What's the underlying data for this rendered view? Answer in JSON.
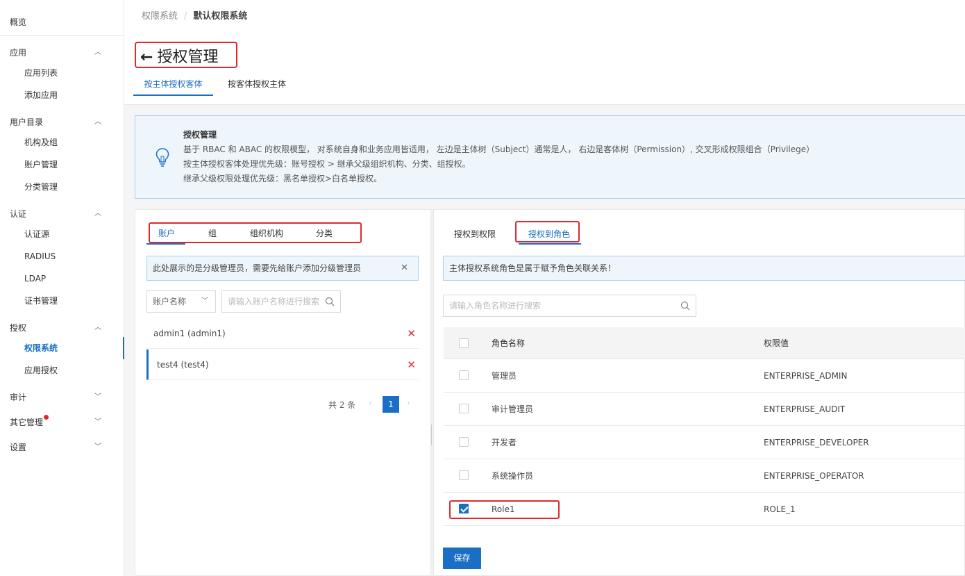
{
  "sidebar": {
    "overview": "概览",
    "groups": [
      {
        "label": "应用",
        "expanded": true,
        "items": [
          "应用列表",
          "添加应用"
        ]
      },
      {
        "label": "用户目录",
        "expanded": true,
        "items": [
          "机构及组",
          "账户管理",
          "分类管理"
        ]
      },
      {
        "label": "认证",
        "expanded": true,
        "items": [
          "认证源",
          "RADIUS",
          "LDAP",
          "证书管理"
        ]
      },
      {
        "label": "授权",
        "expanded": true,
        "items": [
          "权限系统",
          "应用授权"
        ]
      },
      {
        "label": "审计",
        "expanded": false,
        "items": []
      },
      {
        "label": "其它管理",
        "expanded": false,
        "items": []
      },
      {
        "label": "设置",
        "expanded": false,
        "items": []
      }
    ],
    "active_item": "权限系统"
  },
  "breadcrumb": {
    "parent": "权限系统",
    "separator": "/",
    "current": "默认权限系统"
  },
  "page_title": "授权管理",
  "top_tabs": [
    "按主体授权客体",
    "按客体授权主体"
  ],
  "info": {
    "title": "授权管理",
    "lines": [
      "基于 RBAC 和 ABAC 的权限模型， 对系统自身和业务应用皆适用， 左边是主体树（Subject）通常是人， 右边是客体树（Permission）, 交叉形成权限组合（Privilege）",
      "按主体授权客体处理优先级：账号授权 > 继承父级组织机构、分类、组授权。",
      "继承父级权限处理优先级：黑名单授权>白名单授权。"
    ]
  },
  "left": {
    "tabs": [
      "账户",
      "组",
      "组织机构",
      "分类"
    ],
    "notice": "此处展示的是分级管理员，需要先给账户添加分级管理员",
    "select_value": "账户名称",
    "search_placeholder": "请输入账户名称进行搜索",
    "accounts": [
      "admin1 (admin1)",
      "test4 (test4)"
    ],
    "pager": {
      "total": "共 2 条",
      "page": "1"
    }
  },
  "right": {
    "tabs": [
      "授权到权限",
      "授权到角色"
    ],
    "notice": "主体授权系统角色是属于赋予角色关联关系！",
    "search_placeholder": "请输入角色名称进行搜索",
    "columns": [
      "角色名称",
      "权限值"
    ],
    "rows": [
      {
        "name": "管理员",
        "value": "ENTERPRISE_ADMIN",
        "checked": false
      },
      {
        "name": "审计管理员",
        "value": "ENTERPRISE_AUDIT",
        "checked": false
      },
      {
        "name": "开发者",
        "value": "ENTERPRISE_DEVELOPER",
        "checked": false
      },
      {
        "name": "系统操作员",
        "value": "ENTERPRISE_OPERATOR",
        "checked": false
      },
      {
        "name": "Role1",
        "value": "ROLE_1",
        "checked": true
      }
    ],
    "save_label": "保存"
  },
  "colors": {
    "accent": "#1a6fc4",
    "highlight": "#e0292f",
    "info_bg": "#eef6fc"
  }
}
